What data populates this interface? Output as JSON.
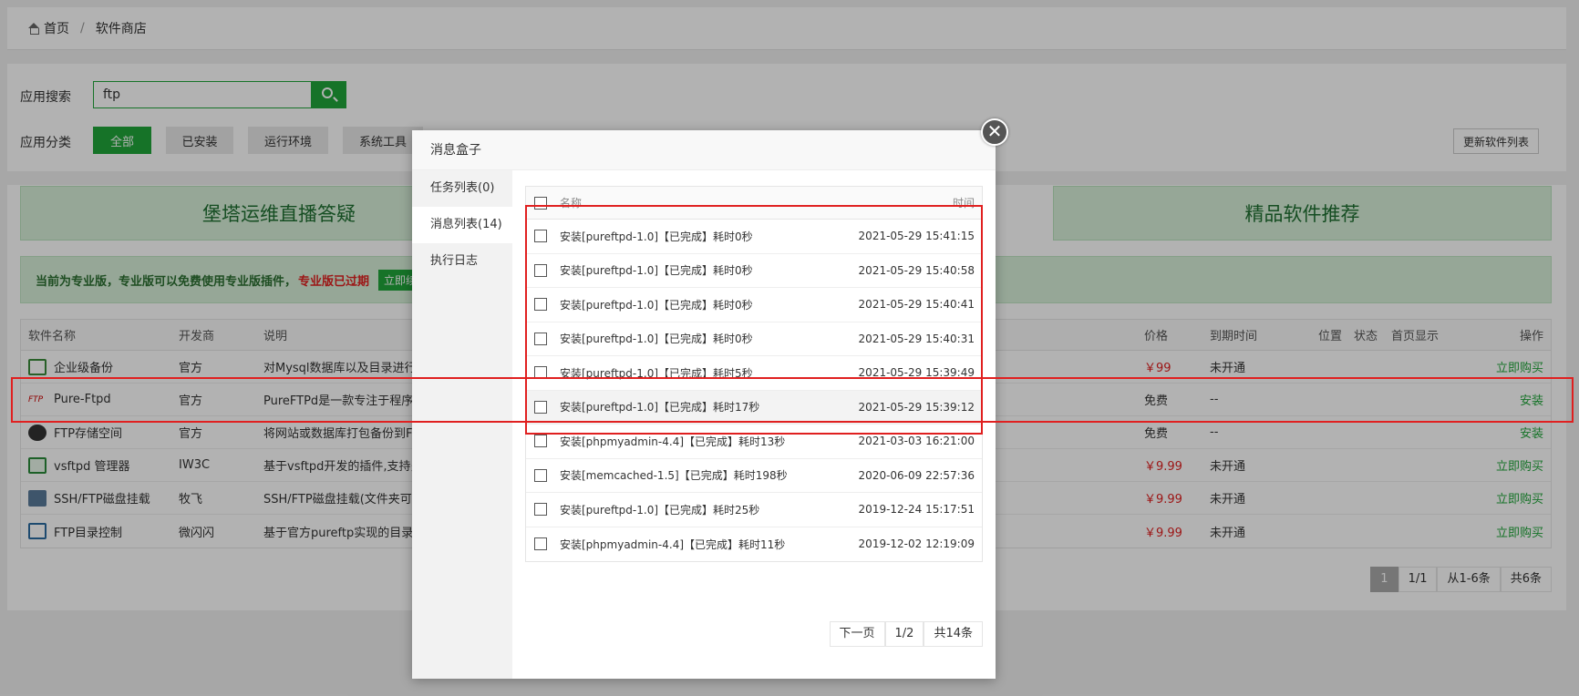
{
  "breadcrumb": {
    "home": "首页",
    "separator": "/",
    "current": "软件商店"
  },
  "search": {
    "label": "应用搜索",
    "value": "ftp"
  },
  "category": {
    "label": "应用分类",
    "items": [
      "全部",
      "已安装",
      "运行环境",
      "系统工具"
    ],
    "update_button": "更新软件列表"
  },
  "banners": {
    "left": "堡塔运维直播答疑",
    "right": "精品软件推荐"
  },
  "notice": {
    "text": "当前为专业版，专业版可以免费使用专业版插件，",
    "expired": "专业版已过期",
    "renew": "立即续"
  },
  "table": {
    "headers": {
      "name": "软件名称",
      "developer": "开发商",
      "desc": "说明",
      "price": "价格",
      "expire": "到期时间",
      "position": "位置",
      "status": "状态",
      "home": "首页显示",
      "action": "操作"
    },
    "rows": [
      {
        "name": "企业级备份",
        "developer": "官方",
        "desc": "对Mysql数据库以及目录进行全",
        "price": "￥99",
        "expire": "未开通",
        "action": "立即购买"
      },
      {
        "name": "Pure-Ftpd",
        "developer": "官方",
        "desc": "PureFTPd是一款专注于程序健",
        "price": "免费",
        "expire": "--",
        "action": "安装"
      },
      {
        "name": "FTP存储空间",
        "developer": "官方",
        "desc": "将网站或数据库打包备份到FTP",
        "price": "免费",
        "expire": "--",
        "action": "安装"
      },
      {
        "name": "vsftpd 管理器",
        "developer": "IW3C",
        "desc": "基于vsftpd开发的插件,支持多用",
        "price": "￥9.99",
        "expire": "未开通",
        "action": "立即购买"
      },
      {
        "name": "SSH/FTP磁盘挂载",
        "developer": "牧飞",
        "desc": "SSH/FTP磁盘挂载(文件夹可以加",
        "price": "￥9.99",
        "expire": "未开通",
        "action": "立即购买"
      },
      {
        "name": "FTP目录控制",
        "developer": "微闪闪",
        "desc": "基于官方pureftp实现的目录容",
        "price": "￥9.99",
        "expire": "未开通",
        "action": "立即购买"
      }
    ]
  },
  "pager": {
    "current": "1",
    "pages": "1/1",
    "range": "从1-6条",
    "total": "共6条"
  },
  "dialog": {
    "title": "消息盒子",
    "close": "✕",
    "tabs": [
      "任务列表(0)",
      "消息列表(14)",
      "执行日志"
    ],
    "columns": {
      "name": "名称",
      "time": "时间"
    },
    "messages": [
      {
        "name": "安装[pureftpd-1.0]【已完成】耗时0秒",
        "time": "2021-05-29 15:41:15"
      },
      {
        "name": "安装[pureftpd-1.0]【已完成】耗时0秒",
        "time": "2021-05-29 15:40:58"
      },
      {
        "name": "安装[pureftpd-1.0]【已完成】耗时0秒",
        "time": "2021-05-29 15:40:41"
      },
      {
        "name": "安装[pureftpd-1.0]【已完成】耗时0秒",
        "time": "2021-05-29 15:40:31"
      },
      {
        "name": "安装[pureftpd-1.0]【已完成】耗时5秒",
        "time": "2021-05-29 15:39:49"
      },
      {
        "name": "安装[pureftpd-1.0]【已完成】耗时17秒",
        "time": "2021-05-29 15:39:12"
      },
      {
        "name": "安装[phpmyadmin-4.4]【已完成】耗时13秒",
        "time": "2021-03-03 16:21:00"
      },
      {
        "name": "安装[memcached-1.5]【已完成】耗时198秒",
        "time": "2020-06-09 22:57:36"
      },
      {
        "name": "安装[pureftpd-1.0]【已完成】耗时25秒",
        "time": "2019-12-24 15:17:51"
      },
      {
        "name": "安装[phpmyadmin-4.4]【已完成】耗时11秒",
        "time": "2019-12-02 12:19:09"
      }
    ],
    "pager": {
      "next": "下一页",
      "pages": "1/2",
      "total": "共14条"
    }
  },
  "colors": {
    "accent": "#20a53a",
    "highlight": "#e02020",
    "price": "#e02020"
  }
}
